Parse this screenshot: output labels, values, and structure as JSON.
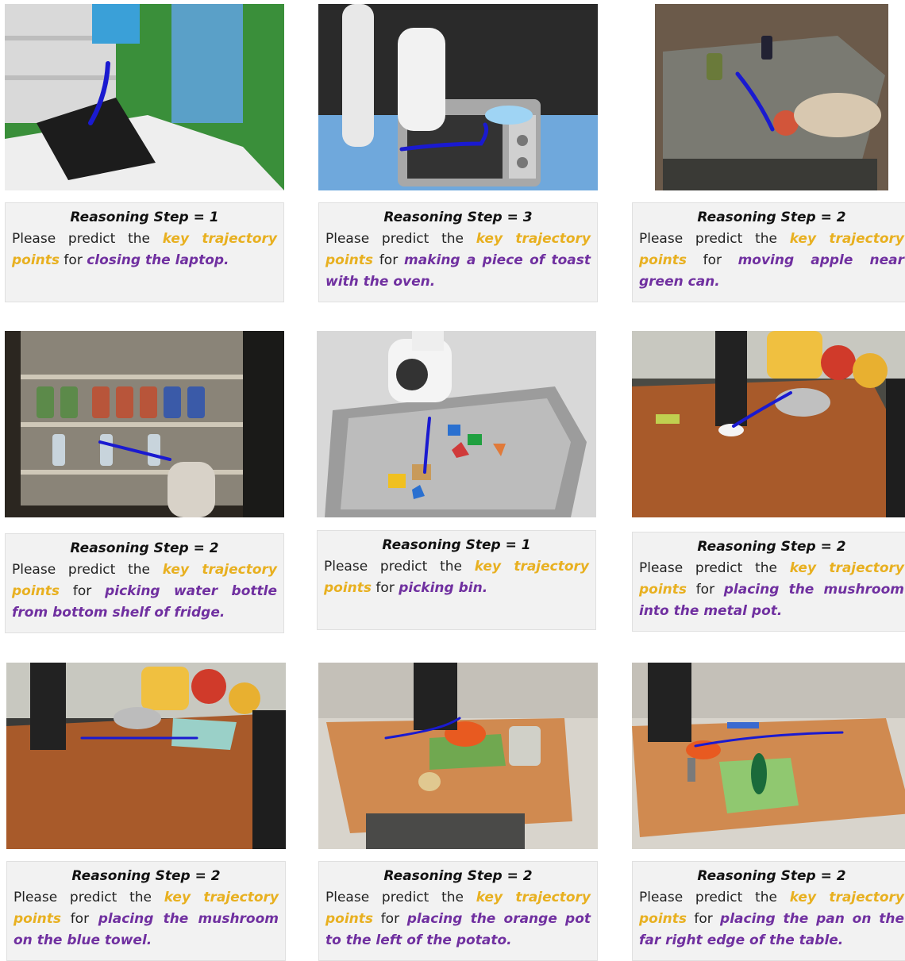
{
  "panels": [
    {
      "step": "Reasoning Step = 1",
      "pre": "Please predict the ",
      "kw": "key trajectory points",
      "mid": " for ",
      "task": "closing the laptop.",
      "scene": "laptop"
    },
    {
      "step": "Reasoning Step = 3",
      "pre": "Please predict the ",
      "kw": "key trajectory points",
      "mid": " for ",
      "task": "making a piece of toast with the oven.",
      "scene": "toaster"
    },
    {
      "step": "Reasoning Step = 2",
      "pre": "Please predict the ",
      "kw": "key trajectory points",
      "mid": " for ",
      "task": "moving apple near green can.",
      "scene": "apple-can"
    },
    {
      "step": "Reasoning Step = 2",
      "pre": "Please predict the ",
      "kw": "key trajectory points",
      "mid": " for ",
      "task": "picking water bottle from bottom shelf of fridge.",
      "scene": "fridge"
    },
    {
      "step": "Reasoning Step = 1",
      "pre": "Please predict the ",
      "kw": "key trajectory points",
      "mid": " for ",
      "task": "picking bin.",
      "scene": "bin"
    },
    {
      "step": "Reasoning Step = 2",
      "pre": "Please predict the ",
      "kw": "key trajectory points",
      "mid": " for ",
      "task": "placing the mushroom into the metal pot.",
      "scene": "kitchen-pot"
    },
    {
      "step": "Reasoning Step = 2",
      "pre": "Please predict the ",
      "kw": "key trajectory points",
      "mid": " for ",
      "task": "placing the mushroom on the blue towel.",
      "scene": "kitchen-towel"
    },
    {
      "step": "Reasoning Step = 2",
      "pre": "Please predict the ",
      "kw": "key trajectory points",
      "mid": " for ",
      "task": "placing the orange pot to the left of the potato.",
      "scene": "kitchen-orange"
    },
    {
      "step": "Reasoning Step = 2",
      "pre": "Please predict the ",
      "kw": "key trajectory points",
      "mid": " for ",
      "task": "placing the pan on the far right edge of the table.",
      "scene": "kitchen-pan"
    }
  ],
  "colors": {
    "keyword": "#e8b020",
    "task": "#7030a0",
    "trajectory": "#1a1ad0"
  }
}
